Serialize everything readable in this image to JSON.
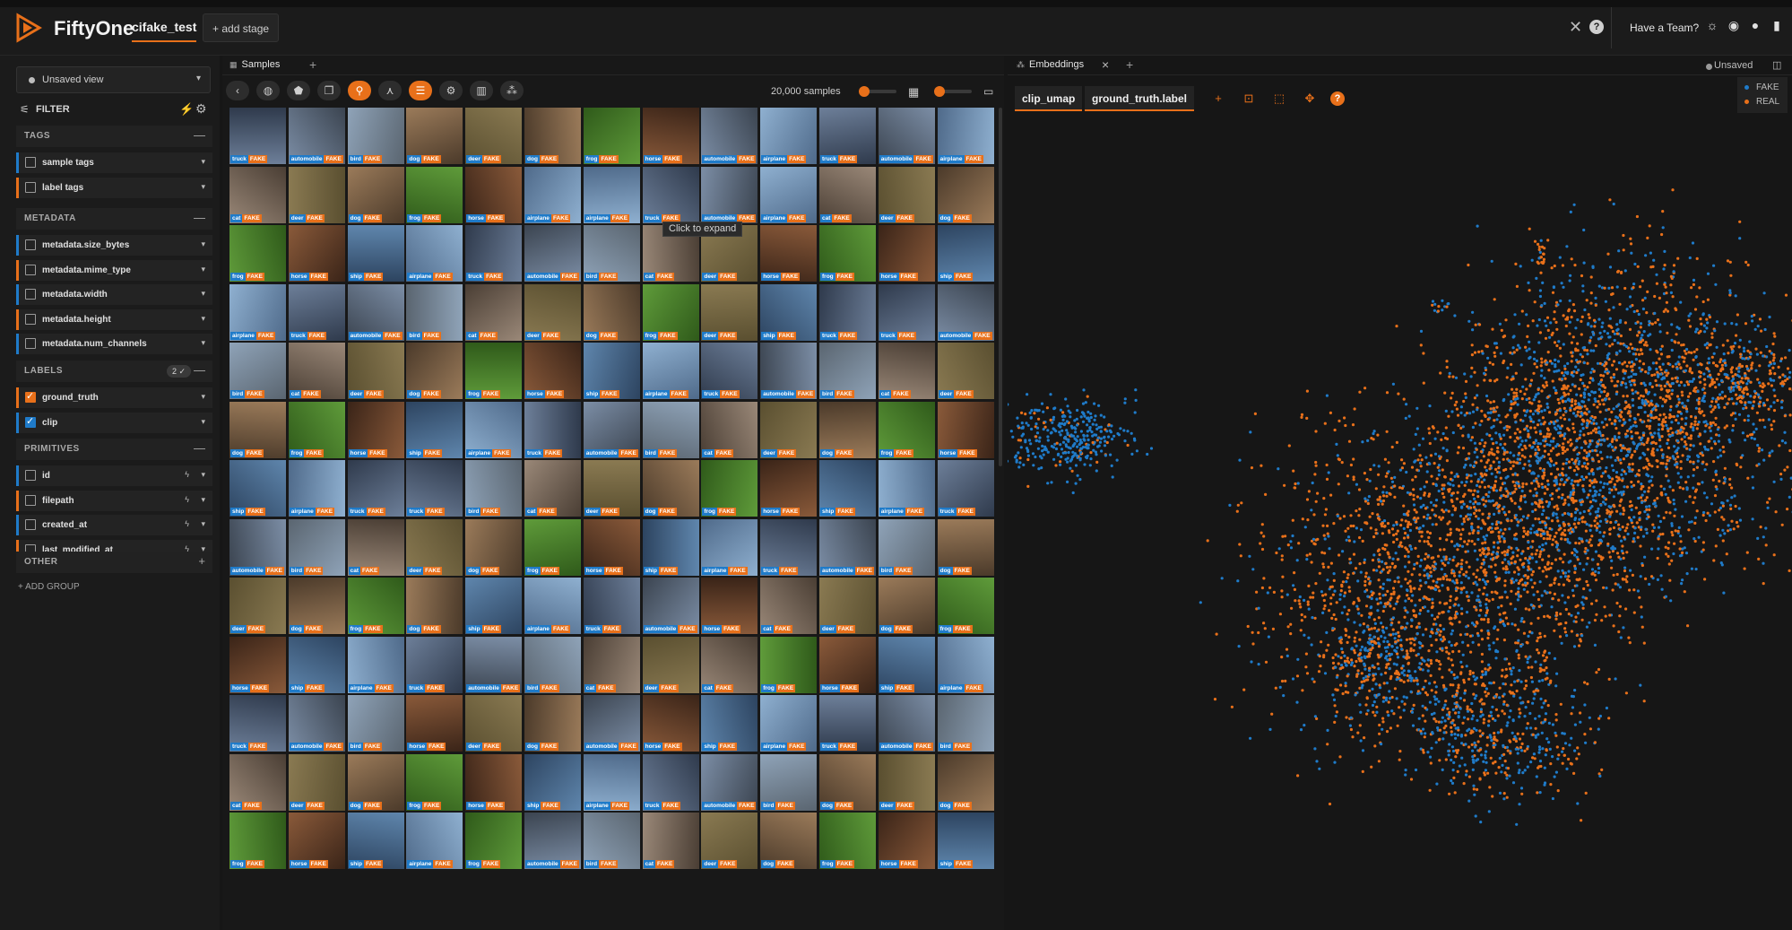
{
  "header": {
    "app_name": "FiftyOne",
    "dataset": "cifake_test",
    "add_stage": "+ add stage",
    "team": "Have a Team?"
  },
  "sidebar": {
    "view": "Unsaved view",
    "filter_label": "FILTER",
    "sections": [
      {
        "label": "TAGS",
        "control": "—"
      },
      {
        "label": "METADATA",
        "control": "—"
      },
      {
        "label": "LABELS",
        "control": "—",
        "badge": "2 ✓"
      },
      {
        "label": "PRIMITIVES",
        "control": "—"
      },
      {
        "label": "OTHER",
        "control": "+"
      }
    ],
    "fields": {
      "tags": [
        {
          "name": "sample tags",
          "color": "#1f7bc9"
        },
        {
          "name": "label tags",
          "color": "#e8701a"
        }
      ],
      "metadata": [
        {
          "name": "metadata.size_bytes",
          "color": "#1f7bc9"
        },
        {
          "name": "metadata.mime_type",
          "color": "#e8701a"
        },
        {
          "name": "metadata.width",
          "color": "#1f7bc9"
        },
        {
          "name": "metadata.height",
          "color": "#e8701a"
        },
        {
          "name": "metadata.num_channels",
          "color": "#1f7bc9"
        }
      ],
      "labels": [
        {
          "name": "ground_truth",
          "color": "#e8701a",
          "checked": true
        },
        {
          "name": "clip",
          "color": "#1f7bc9",
          "checked": true
        }
      ],
      "primitives": [
        {
          "name": "id",
          "color": "#1f7bc9"
        },
        {
          "name": "filepath",
          "color": "#e8701a"
        },
        {
          "name": "created_at",
          "color": "#1f7bc9"
        },
        {
          "name": "last_modified_at",
          "color": "#e8701a"
        }
      ]
    },
    "add_group": "+ ADD GROUP"
  },
  "samples": {
    "tab": "Samples",
    "count": "20,000 samples",
    "tooltip": "Click to expand",
    "class_label": "FAKE",
    "grid": [
      [
        "truck",
        "automobile",
        "bird",
        "dog",
        "deer",
        "dog",
        "frog",
        "horse",
        "automobile",
        "airplane",
        "truck",
        "automobile",
        "airplane"
      ],
      [
        "cat",
        "deer",
        "dog",
        "frog",
        "horse",
        "airplane",
        "airplane",
        "truck",
        "automobile",
        "airplane",
        "cat",
        "deer",
        "dog"
      ],
      [
        "frog",
        "horse",
        "ship",
        "airplane",
        "truck",
        "automobile",
        "bird",
        "cat",
        "deer",
        "horse",
        "frog",
        "horse",
        "ship"
      ],
      [
        "airplane",
        "truck",
        "automobile",
        "bird",
        "cat",
        "deer",
        "dog",
        "frog",
        "deer",
        "ship",
        "truck",
        "truck",
        "automobile"
      ],
      [
        "bird",
        "cat",
        "deer",
        "dog",
        "frog",
        "horse",
        "ship",
        "airplane",
        "truck",
        "automobile",
        "bird",
        "cat",
        "deer"
      ],
      [
        "dog",
        "frog",
        "horse",
        "ship",
        "airplane",
        "truck",
        "automobile",
        "bird",
        "cat",
        "deer",
        "dog",
        "frog",
        "horse"
      ],
      [
        "ship",
        "airplane",
        "truck",
        "truck",
        "bird",
        "cat",
        "deer",
        "dog",
        "frog",
        "horse",
        "ship",
        "airplane",
        "truck"
      ],
      [
        "automobile",
        "bird",
        "cat",
        "deer",
        "dog",
        "frog",
        "horse",
        "ship",
        "airplane",
        "truck",
        "automobile",
        "bird",
        "dog"
      ],
      [
        "deer",
        "dog",
        "frog",
        "dog",
        "ship",
        "airplane",
        "truck",
        "automobile",
        "horse",
        "cat",
        "deer",
        "dog",
        "frog"
      ],
      [
        "horse",
        "ship",
        "airplane",
        "truck",
        "automobile",
        "bird",
        "cat",
        "deer",
        "cat",
        "frog",
        "horse",
        "ship",
        "airplane"
      ],
      [
        "truck",
        "automobile",
        "bird",
        "horse",
        "deer",
        "dog",
        "automobile",
        "horse",
        "ship",
        "airplane",
        "truck",
        "automobile",
        "bird"
      ],
      [
        "cat",
        "deer",
        "dog",
        "frog",
        "horse",
        "ship",
        "airplane",
        "truck",
        "automobile",
        "bird",
        "dog",
        "deer",
        "dog"
      ],
      [
        "frog",
        "horse",
        "ship",
        "airplane",
        "frog",
        "automobile",
        "bird",
        "cat",
        "deer",
        "dog",
        "frog",
        "horse",
        "ship"
      ]
    ]
  },
  "embeddings": {
    "tab": "Embeddings",
    "unsaved": "Unsaved",
    "brain_key": "clip_umap",
    "color_by": "ground_truth.label",
    "legend": [
      {
        "label": "FAKE",
        "color": "#1f7bc9"
      },
      {
        "label": "REAL",
        "color": "#e8701a"
      }
    ]
  }
}
